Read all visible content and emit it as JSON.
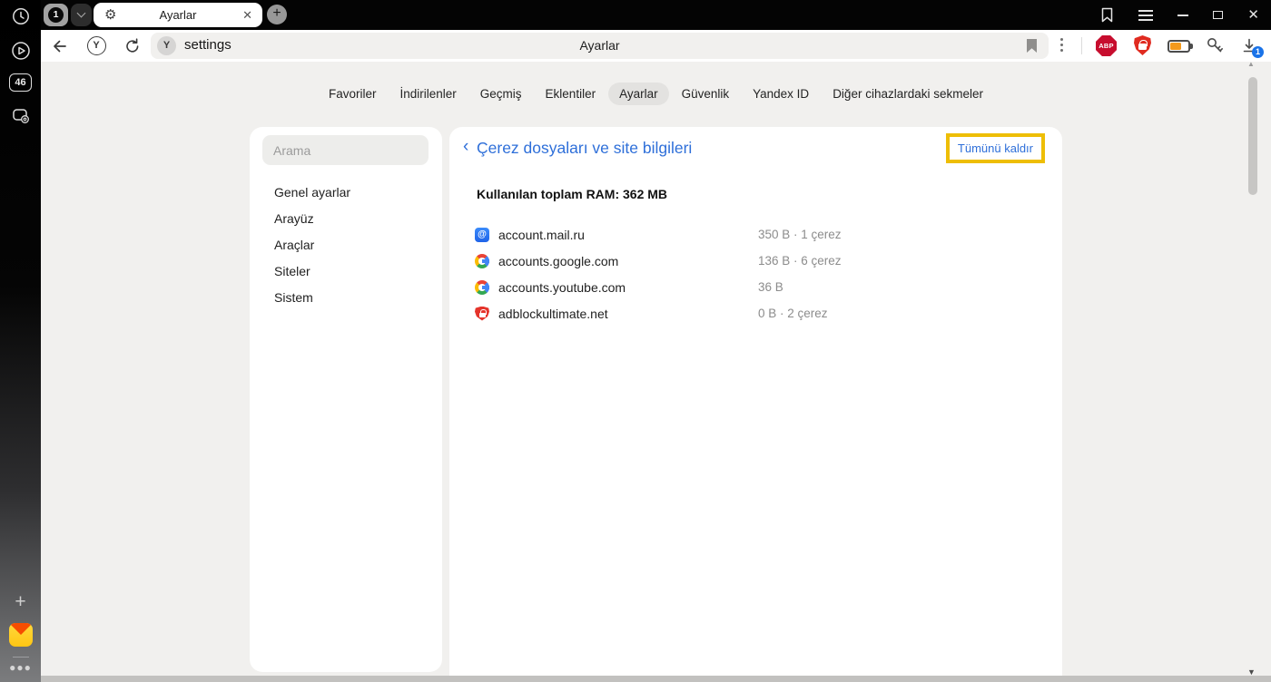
{
  "rail": {
    "counter": "46"
  },
  "tab_bar": {
    "group_badge": "1",
    "tab_title": "Ayarlar",
    "close_glyph": "✕",
    "new_tab_glyph": "+",
    "gear_glyph": "⚙"
  },
  "toolbar": {
    "url": "settings",
    "center_title": "Ayarlar",
    "abp_label": "ABP",
    "download_badge": "1",
    "yandex_letter": "Y"
  },
  "nav": {
    "items": [
      {
        "label": "Favoriler",
        "active": false
      },
      {
        "label": "İndirilenler",
        "active": false
      },
      {
        "label": "Geçmiş",
        "active": false
      },
      {
        "label": "Eklentiler",
        "active": false
      },
      {
        "label": "Ayarlar",
        "active": true
      },
      {
        "label": "Güvenlik",
        "active": false
      },
      {
        "label": "Yandex ID",
        "active": false
      },
      {
        "label": "Diğer cihazlardaki sekmeler",
        "active": false
      }
    ]
  },
  "settings_sidebar": {
    "search_placeholder": "Arama",
    "items": [
      {
        "label": "Genel ayarlar"
      },
      {
        "label": "Arayüz"
      },
      {
        "label": "Araçlar"
      },
      {
        "label": "Siteler"
      },
      {
        "label": "Sistem"
      }
    ]
  },
  "cookies": {
    "back_glyph": "‹",
    "title": "Çerez dosyaları ve site bilgileri",
    "remove_all_label": "Tümünü kaldır",
    "ram_line": "Kullanılan toplam RAM: 362 MB",
    "sites": [
      {
        "icon": "mailru-icon",
        "name": "account.mail.ru",
        "info": "350 B · 1 çerez"
      },
      {
        "icon": "google-icon",
        "name": "accounts.google.com",
        "info": "136 B · 6 çerez"
      },
      {
        "icon": "google-icon",
        "name": "accounts.youtube.com",
        "info": "36 B"
      },
      {
        "icon": "adblockultimate-icon",
        "name": "adblockultimate.net",
        "info": "0 B · 2 çerez"
      }
    ]
  },
  "colors": {
    "accent_blue": "#2e6fd9",
    "annotation_yellow": "#eebe05",
    "abp_red": "#c70d2e",
    "shield_red": "#e02b20",
    "battery_orange": "#f49a1c",
    "badge_blue": "#1a73e8"
  }
}
